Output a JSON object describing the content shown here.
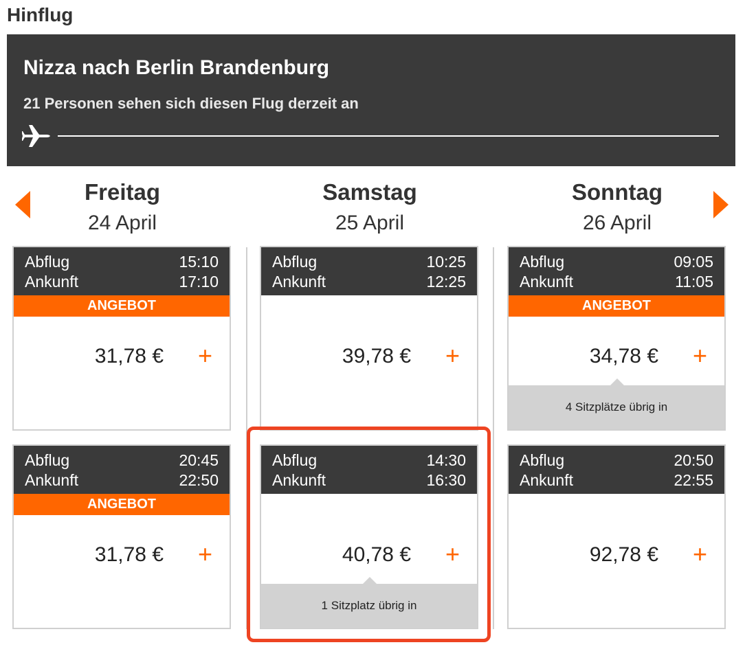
{
  "section": {
    "title": "Hinflug"
  },
  "route": {
    "title": "Nizza nach Berlin Brandenburg",
    "viewers": "21 Personen sehen sich diesen Flug derzeit an"
  },
  "colors": {
    "accent": "#ff6600",
    "header_bg": "#3a3a3a",
    "highlight": "#ee4422",
    "seats_bg": "#d2d2d2"
  },
  "icons": {
    "prev": "chevron-left-icon",
    "next": "chevron-right-icon",
    "plane": "plane-icon",
    "add": "plus-icon"
  },
  "days": [
    {
      "name": "Freitag",
      "date": "24 April"
    },
    {
      "name": "Samstag",
      "date": "25 April"
    },
    {
      "name": "Sonntag",
      "date": "26 April"
    }
  ],
  "labels": {
    "departure": "Abflug",
    "arrival": "Ankunft",
    "plus": "+"
  },
  "flights": {
    "fri1": {
      "departure": "15:10",
      "arrival": "17:10",
      "badge": "ANGEBOT",
      "price": "31,78 €"
    },
    "fri2": {
      "departure": "20:45",
      "arrival": "22:50",
      "badge": "ANGEBOT",
      "price": "31,78 €"
    },
    "sat1": {
      "departure": "10:25",
      "arrival": "12:25",
      "price": "39,78 €"
    },
    "sat2": {
      "departure": "14:30",
      "arrival": "16:30",
      "price": "40,78 €",
      "seats": "1 Sitzplatz übrig in",
      "selected": true
    },
    "sun1": {
      "departure": "09:05",
      "arrival": "11:05",
      "badge": "ANGEBOT",
      "price": "34,78 €",
      "seats": "4 Sitzplätze übrig in"
    },
    "sun2": {
      "departure": "20:50",
      "arrival": "22:55",
      "price": "92,78 €"
    }
  }
}
